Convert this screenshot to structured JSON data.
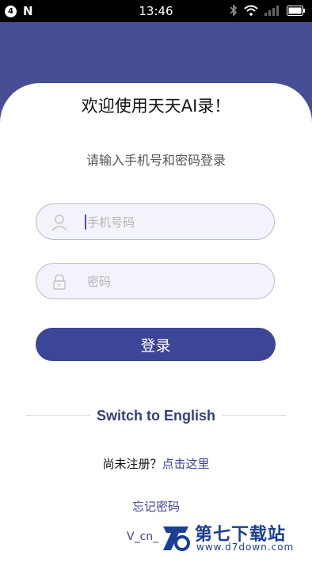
{
  "status_bar": {
    "notification_count": "4",
    "app_icon_letter": "N",
    "time": "13:46",
    "icons": [
      "bluetooth-icon",
      "wifi-icon",
      "signal-icon",
      "battery-icon"
    ]
  },
  "colors": {
    "header": "#474e94",
    "primary_button": "#3d4596",
    "link": "#3d4596",
    "switch_language_text": "#34407a"
  },
  "login": {
    "title": "欢迎使用天天AI录！",
    "subtitle": "请输入手机号和密码登录",
    "phone": {
      "value": "",
      "placeholder": "手机号码",
      "icon": "user-icon"
    },
    "password": {
      "value": "",
      "placeholder": "密码",
      "icon": "lock-icon"
    },
    "login_button": "登录",
    "switch_language": "Switch to English",
    "register_prompt": "尚未注册？",
    "register_link": "点击这里",
    "forgot_password": "忘记密码",
    "version": "V_cn_"
  },
  "watermark": {
    "title": "第七下载站",
    "url": "www.d7down.com"
  }
}
